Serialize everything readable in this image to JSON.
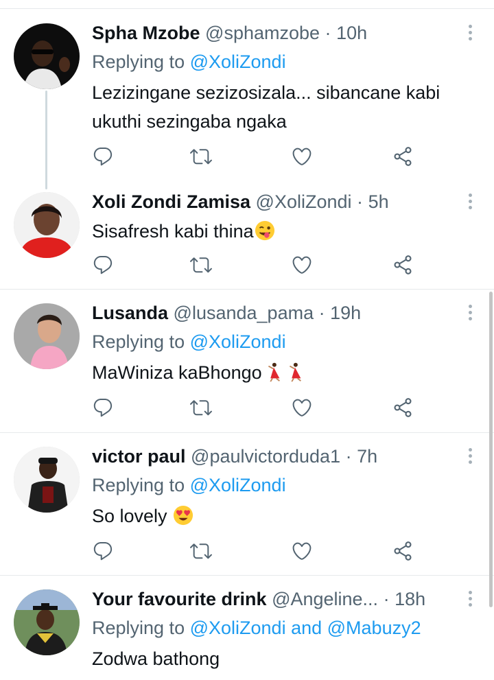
{
  "tweets": [
    {
      "name": "Spha Mzobe",
      "handle": "@sphamzobe",
      "dot": "·",
      "time": "10h",
      "replying_prefix": "Replying to ",
      "replying_to": "@XoliZondi",
      "replying_and": "",
      "replying_to_2": "",
      "text_line1": "Lezizingane sezizosizala... sibancane kabi",
      "text_line2": "ukuthi sezingaba ngaka",
      "avatar": "avatar-man-sunglasses"
    },
    {
      "name": "Xoli Zondi Zamisa",
      "handle": "@XoliZondi",
      "dot": "·",
      "time": "5h",
      "text_line1": "Sisafresh kabi thina",
      "emoji": "winking-tongue-face",
      "avatar": "avatar-woman-red"
    },
    {
      "name": "Lusanda",
      "handle": "@lusanda_pama",
      "dot": "·",
      "time": "19h",
      "replying_prefix": "Replying to ",
      "replying_to": "@XoliZondi",
      "text_line1": "MaWiniza kaBhongo",
      "emoji": "dancer-x2",
      "avatar": "avatar-child"
    },
    {
      "name": "victor paul",
      "handle": "@paulvictorduda1",
      "dot": "·",
      "time": "7h",
      "replying_prefix": "Replying to ",
      "replying_to": "@XoliZondi",
      "text_line1": "So lovely",
      "emoji": "heart-eyes-face",
      "avatar": "avatar-man-cap"
    },
    {
      "name": "Your favourite drink",
      "handle": "@Angeline...",
      "dot": "·",
      "time": "18h",
      "replying_prefix": "Replying to ",
      "replying_to": "@XoliZondi",
      "replying_and": " and ",
      "replying_to_2": "@Mabuzy2",
      "text_line1": "Zodwa bathong",
      "avatar": "avatar-graduate"
    }
  ],
  "icons": [
    "reply-icon",
    "retweet-icon",
    "like-icon",
    "share-icon",
    "more-icon"
  ],
  "colors": {
    "link": "#1d9bf0",
    "secondary_text": "#536471",
    "icon": "#536471",
    "divider": "#e6e9eb"
  }
}
